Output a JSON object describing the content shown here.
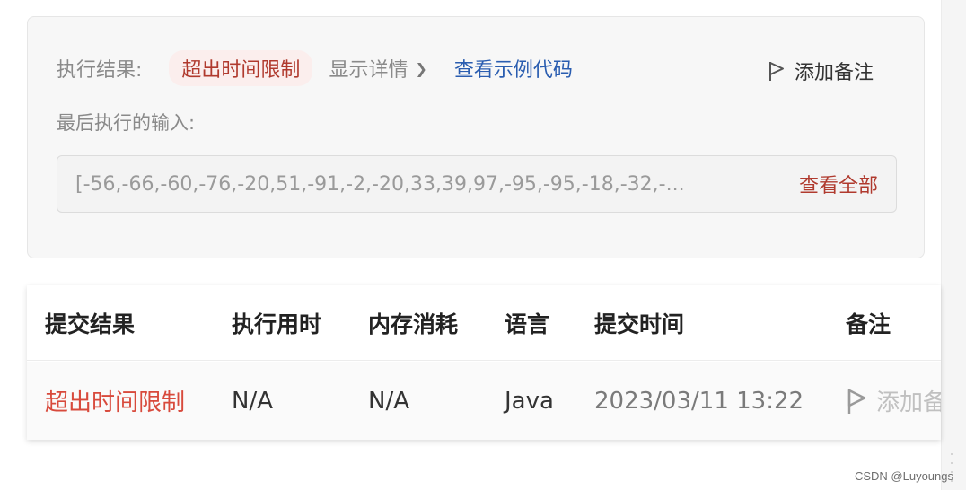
{
  "result_panel": {
    "result_label": "执行结果:",
    "status": "超出时间限制",
    "show_details": "显示详情",
    "view_sample_code": "查看示例代码",
    "add_note": "添加备注",
    "last_input_label": "最后执行的输入:",
    "last_input_value": "[-56,-66,-60,-76,-20,51,-91,-2,-20,33,39,97,-95,-95,-18,-32,-...",
    "view_all": "查看全部"
  },
  "submission_table": {
    "headers": [
      "提交结果",
      "执行用时",
      "内存消耗",
      "语言",
      "提交时间",
      "备注"
    ],
    "rows": [
      {
        "status": "超出时间限制",
        "runtime": "N/A",
        "memory": "N/A",
        "language": "Java",
        "submitted_at": "2023/03/11 13:22",
        "note_action": "添加备注"
      }
    ]
  },
  "watermark": "CSDN @Luyoungs",
  "colors": {
    "status_red": "#d84a3c",
    "status_pill_text": "#b03a2e",
    "status_pill_bg": "#fbeeed",
    "link_blue": "#2a5db0",
    "muted_text": "#8a8a8a",
    "card_bg": "#f7f7f7"
  },
  "icons": {
    "details_chevron": "chevron-right-icon",
    "note_flag": "flag-icon"
  }
}
